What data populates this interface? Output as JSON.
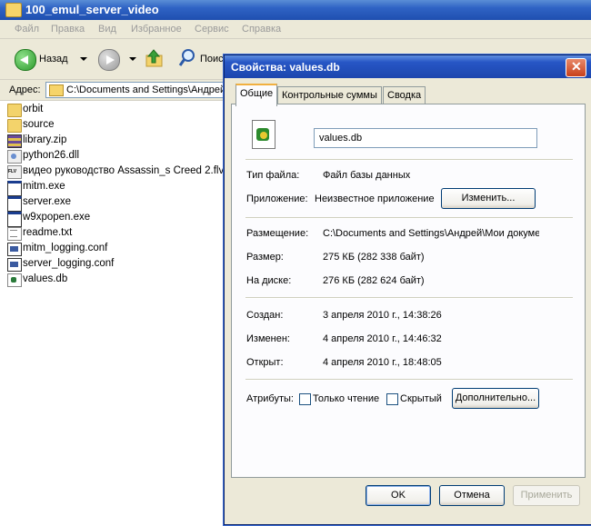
{
  "explorer": {
    "title": "100_emul_server_video",
    "menu": [
      "Файл",
      "Правка",
      "Вид",
      "Избранное",
      "Сервис",
      "Справка"
    ],
    "toolbar": {
      "back_label": "Назад",
      "search_label": "Поиск"
    },
    "address": {
      "label": "Адрес:",
      "value": "C:\\Documents and Settings\\Андрей"
    },
    "files": [
      {
        "name": "orbit",
        "icon": "folder-icon"
      },
      {
        "name": "source",
        "icon": "folder-icon"
      },
      {
        "name": "library.zip",
        "icon": "zip-icon"
      },
      {
        "name": "python26.dll",
        "icon": "dll-icon"
      },
      {
        "name": "видео руководство Assassin_s Creed 2.flv",
        "icon": "flv-icon"
      },
      {
        "name": "mitm.exe",
        "icon": "exe-icon"
      },
      {
        "name": "server.exe",
        "icon": "exe-icon"
      },
      {
        "name": "w9xpopen.exe",
        "icon": "exe-icon"
      },
      {
        "name": "readme.txt",
        "icon": "txt-icon"
      },
      {
        "name": "mitm_logging.conf",
        "icon": "conf-icon"
      },
      {
        "name": "server_logging.conf",
        "icon": "conf-icon"
      },
      {
        "name": "values.db",
        "icon": "db-icon"
      }
    ]
  },
  "dialog": {
    "title": "Свойства: values.db",
    "close_glyph": "✕",
    "tabs": [
      "Общие",
      "Контрольные суммы",
      "Сводка"
    ],
    "file_name": "values.db",
    "file_type_label": "Тип файла:",
    "file_type_value": "Файл базы данных",
    "app_label": "Приложение:",
    "app_value": "Неизвестное приложение",
    "change_button": "Изменить...",
    "location_label": "Размещение:",
    "location_value": "C:\\Documents and Settings\\Андрей\\Мои документы",
    "size_label": "Размер:",
    "size_value": "275 КБ (282 338 байт)",
    "disk_label": "На диске:",
    "disk_value": "276 КБ (282 624 байт)",
    "created_label": "Создан:",
    "created_value": "3 апреля 2010 г., 14:38:26",
    "modified_label": "Изменен:",
    "modified_value": "4 апреля 2010 г., 14:46:32",
    "opened_label": "Открыт:",
    "opened_value": "4 апреля 2010 г., 18:48:05",
    "attributes_label": "Атрибуты:",
    "readonly_label": "Только чтение",
    "hidden_label": "Скрытый",
    "advanced_button": "Дополнительно...",
    "ok_button": "OK",
    "cancel_button": "Отмена",
    "apply_button": "Применить"
  }
}
